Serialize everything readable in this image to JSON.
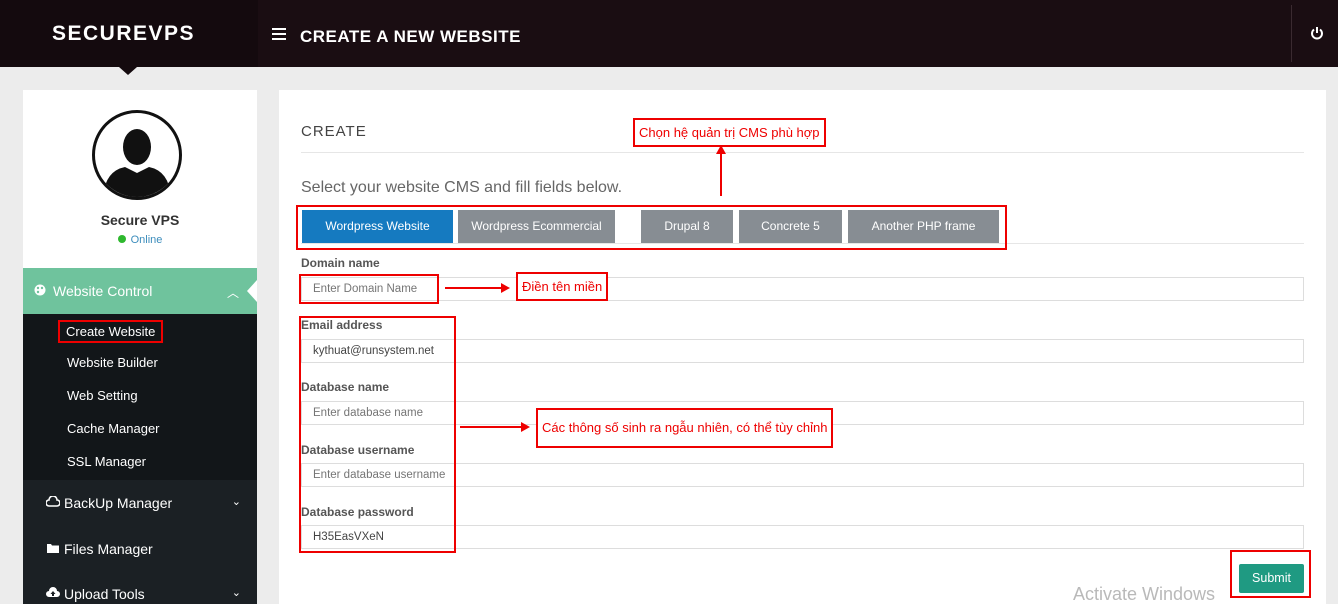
{
  "app": {
    "brand": "SECUREVPS",
    "page_title": "CREATE A NEW WEBSITE"
  },
  "icons": {
    "menu": "hamburger-icon",
    "power": "power-icon",
    "avatar": "user-silhouette-icon"
  },
  "user": {
    "name": "Secure VPS",
    "status": "Online"
  },
  "sidebar": {
    "active_section": {
      "label": "Website Control",
      "icon": "palette-icon"
    },
    "subitems": [
      "Create Website",
      "Website Builder",
      "Web Setting",
      "Cache Manager",
      "SSL Manager"
    ],
    "items": [
      {
        "label": "BackUp Manager",
        "icon": "cloud-icon"
      },
      {
        "label": "Files Manager",
        "icon": "folder-icon"
      },
      {
        "label": "Upload Tools",
        "icon": "upload-icon"
      }
    ]
  },
  "main": {
    "section_title": "CREATE",
    "subtitle": "Select your website CMS and fill fields below.",
    "tabs": [
      "Wordpress Website",
      "Wordpress Ecommercial",
      "Drupal 8",
      "Concrete 5",
      "Another PHP frame"
    ],
    "active_tab": "Wordpress Website",
    "fields": {
      "domain": {
        "label": "Domain name",
        "placeholder": "Enter Domain Name",
        "value": ""
      },
      "email": {
        "label": "Email address",
        "value": "kythuat@runsystem.net"
      },
      "db_name": {
        "label": "Database name",
        "placeholder": "Enter database name",
        "value": ""
      },
      "db_user": {
        "label": "Database username",
        "placeholder": "Enter database username",
        "value": ""
      },
      "db_pass": {
        "label": "Database password",
        "value": "H35EasVXeN"
      }
    },
    "submit_label": "Submit"
  },
  "annotations": {
    "cms_note": "Chọn hệ quản trị CMS phù hợp",
    "domain_note": "Điền tên miền",
    "params_note": "Các thông số sinh ra ngẫu nhiên, có thể tùy chỉnh"
  },
  "watermark": "Activate Windows",
  "colors": {
    "accent_green": "#6fc39d",
    "tab_active": "#157ac0",
    "submit": "#1f9a82",
    "annotation_red": "#e00000"
  }
}
